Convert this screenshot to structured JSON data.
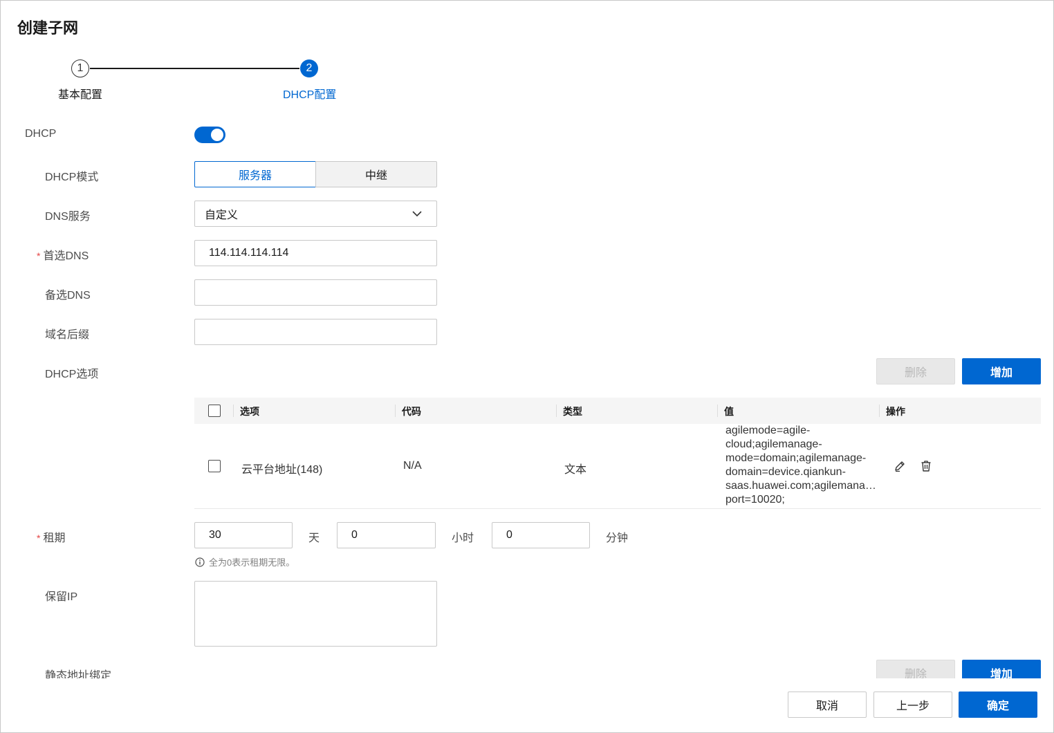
{
  "dialog": {
    "title": "创建子网",
    "steps": [
      {
        "number": "1",
        "label": "基本配置",
        "state": "done"
      },
      {
        "number": "2",
        "label": "DHCP配置",
        "state": "active"
      }
    ]
  },
  "form": {
    "dhcp_label": "DHCP",
    "dhcp_enabled": true,
    "mode": {
      "label": "DHCP模式",
      "options": [
        "服务器",
        "中继"
      ],
      "selected": "服务器"
    },
    "dns_service": {
      "label": "DNS服务",
      "value": "自定义"
    },
    "primary_dns": {
      "required_mark": "*",
      "label": "首选DNS",
      "value": "114.114.114.114"
    },
    "secondary_dns": {
      "label": "备选DNS",
      "value": ""
    },
    "domain_suffix": {
      "label": "域名后缀",
      "value": ""
    },
    "dhcp_options": {
      "label": "DHCP选项",
      "delete_label": "删除",
      "add_label": "增加",
      "columns": [
        "选项",
        "代码",
        "类型",
        "值",
        "操作"
      ],
      "rows": [
        {
          "option": "云平台地址(148)",
          "code": "N/A",
          "type": "文本",
          "value_lines": [
            "agilemode=agile-",
            "cloud;agilemanage-",
            "mode=domain;agilemanage-",
            "domain=device.qiankun-",
            "saas.huawei.com;agilemanage-",
            "port=10020;"
          ]
        }
      ]
    },
    "lease": {
      "required_mark": "*",
      "label": "租期",
      "days": "30",
      "days_unit": "天",
      "hours": "0",
      "hours_unit": "小时",
      "minutes": "0",
      "minutes_unit": "分钟",
      "hint": "全为0表示租期无限。"
    },
    "reserved_ip": {
      "label": "保留IP",
      "value": ""
    },
    "static_binding": {
      "label": "静态地址绑定",
      "delete_label": "删除",
      "add_label": "增加"
    }
  },
  "footer": {
    "cancel_label": "取消",
    "prev_label": "上一步",
    "confirm_label": "确定"
  },
  "colors": {
    "primary": "#0067d1",
    "required": "#e54545",
    "border": "#c8c8c8"
  }
}
